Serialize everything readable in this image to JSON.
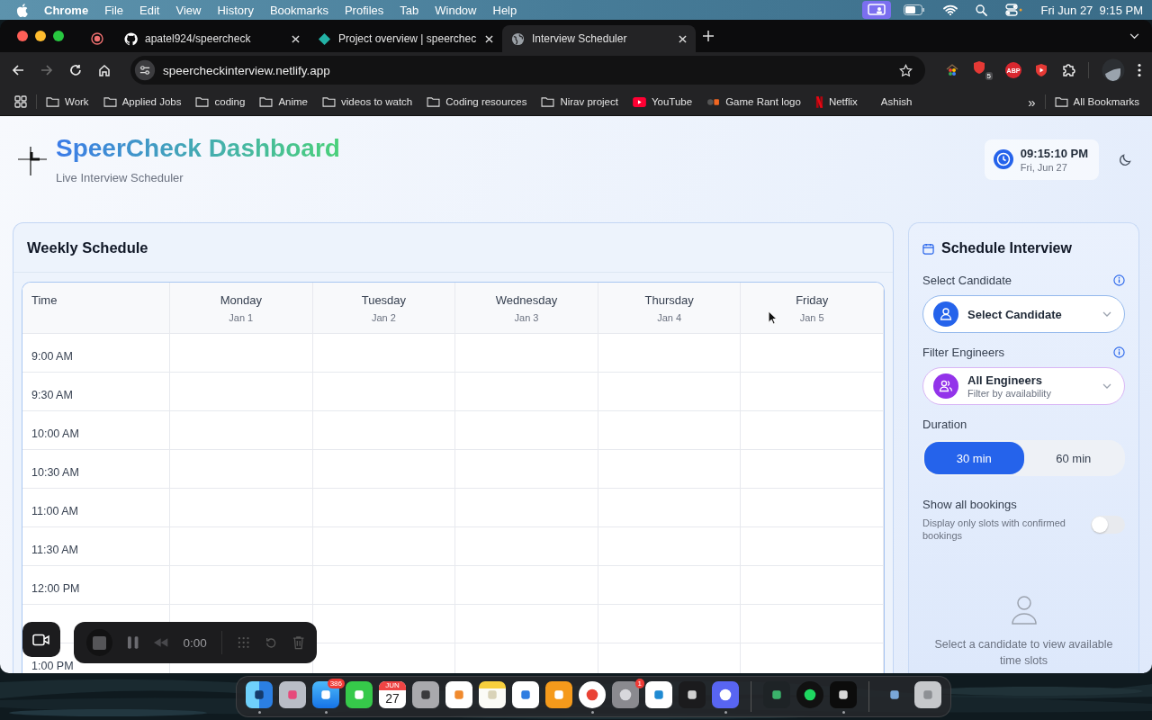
{
  "menu_bar": {
    "app": "Chrome",
    "menus": [
      "File",
      "Edit",
      "View",
      "History",
      "Bookmarks",
      "Profiles",
      "Tab",
      "Window",
      "Help"
    ],
    "status": [
      {
        "kind": "screen-share",
        "active": true
      },
      {
        "kind": "battery",
        "active": false
      },
      {
        "kind": "wifi",
        "active": false
      },
      {
        "kind": "search",
        "active": false
      },
      {
        "kind": "control-center",
        "active": false
      }
    ],
    "clock": "Fri Jun 27  9:15 PM"
  },
  "browser": {
    "pinned_tab": {
      "kind": "record"
    },
    "tabs": [
      {
        "title": "apatel924/speercheck",
        "kind": "repo",
        "selected": false
      },
      {
        "title": "Project overview | speerchec",
        "kind": "diamond",
        "selected": false
      },
      {
        "title": "Interview Scheduler",
        "kind": "globe",
        "selected": true
      }
    ],
    "url": "speercheckinterview.netlify.app",
    "extensions": [
      {
        "kind": "house"
      },
      {
        "kind": "shield",
        "badge": "5"
      },
      {
        "kind": "stop-sign",
        "label": "ABP"
      },
      {
        "kind": "play-shield"
      },
      {
        "kind": "puzzle"
      }
    ],
    "bookmarks": [
      {
        "label": "Work",
        "kind": "folder"
      },
      {
        "label": "Applied Jobs",
        "kind": "folder"
      },
      {
        "label": "coding",
        "kind": "folder"
      },
      {
        "label": "Anime",
        "kind": "folder"
      },
      {
        "label": "videos to watch",
        "kind": "folder"
      },
      {
        "label": "Coding resources",
        "kind": "folder"
      },
      {
        "label": "Nirav project",
        "kind": "folder"
      },
      {
        "label": "YouTube",
        "kind": "play"
      },
      {
        "label": "Game Rant logo",
        "kind": "dots"
      },
      {
        "label": "Netflix",
        "kind": "red-bar"
      },
      {
        "label": "Ashish",
        "kind": "none"
      }
    ],
    "overflow": "»",
    "all_bookmarks": "All Bookmarks"
  },
  "page": {
    "title": "SpeerCheck Dashboard",
    "subtitle": "Live Interview Scheduler",
    "clock": {
      "time": "09:15:10 PM",
      "date": "Fri, Jun 27"
    },
    "schedule": {
      "title": "Weekly Schedule",
      "time_header": "Time",
      "days": [
        {
          "day": "Monday",
          "date": "Jan 1"
        },
        {
          "day": "Tuesday",
          "date": "Jan 2"
        },
        {
          "day": "Wednesday",
          "date": "Jan 3"
        },
        {
          "day": "Thursday",
          "date": "Jan 4"
        },
        {
          "day": "Friday",
          "date": "Jan 5"
        }
      ],
      "rows": [
        {
          "time": "9:00 AM"
        },
        {
          "time": "9:30 AM"
        },
        {
          "time": "10:00 AM"
        },
        {
          "time": "10:30 AM"
        },
        {
          "time": "11:00 AM"
        },
        {
          "time": "11:30 AM"
        },
        {
          "time": "12:00 PM"
        },
        {},
        {
          "time": "1:00 PM"
        }
      ]
    },
    "form": {
      "title": "Schedule Interview",
      "candidate": {
        "label": "Select Candidate",
        "value": "Select Candidate"
      },
      "engineers": {
        "label": "Filter Engineers",
        "value": "All Engineers",
        "hint": "Filter by availability"
      },
      "duration": {
        "label": "Duration",
        "options": [
          {
            "label": "30 min",
            "selected": true
          },
          {
            "label": "60 min",
            "selected": false
          }
        ]
      },
      "show_all": {
        "label": "Show all bookings",
        "description": "Display only slots with confirmed bookings",
        "on": false
      },
      "empty": "Select a candidate to view available time slots"
    }
  },
  "recorder": {
    "timer": "0:00"
  },
  "dock": [
    {
      "kind": "finder",
      "running": true
    },
    {
      "kind": "launchpad",
      "running": false
    },
    {
      "kind": "mail",
      "running": true,
      "badge": "386"
    },
    {
      "kind": "facetime",
      "running": false
    },
    {
      "kind": "calendar",
      "running": false,
      "month": "JUN",
      "day": "27"
    },
    {
      "kind": "calculator",
      "running": false
    },
    {
      "kind": "reminders",
      "running": false
    },
    {
      "kind": "notes",
      "running": false
    },
    {
      "kind": "freeform",
      "running": false
    },
    {
      "kind": "pencil",
      "running": false
    },
    {
      "kind": "chrome",
      "running": true
    },
    {
      "kind": "settings",
      "running": false,
      "badge": "1"
    },
    {
      "kind": "code",
      "running": false
    },
    {
      "kind": "terminal",
      "running": false
    },
    {
      "kind": "discord",
      "running": true
    },
    {
      "kind": "divider"
    },
    {
      "kind": "monitor",
      "running": false
    },
    {
      "kind": "spotify",
      "running": false
    },
    {
      "kind": "cube",
      "running": true
    },
    {
      "kind": "divider"
    },
    {
      "kind": "stack",
      "running": false
    },
    {
      "kind": "trash",
      "running": false
    }
  ]
}
